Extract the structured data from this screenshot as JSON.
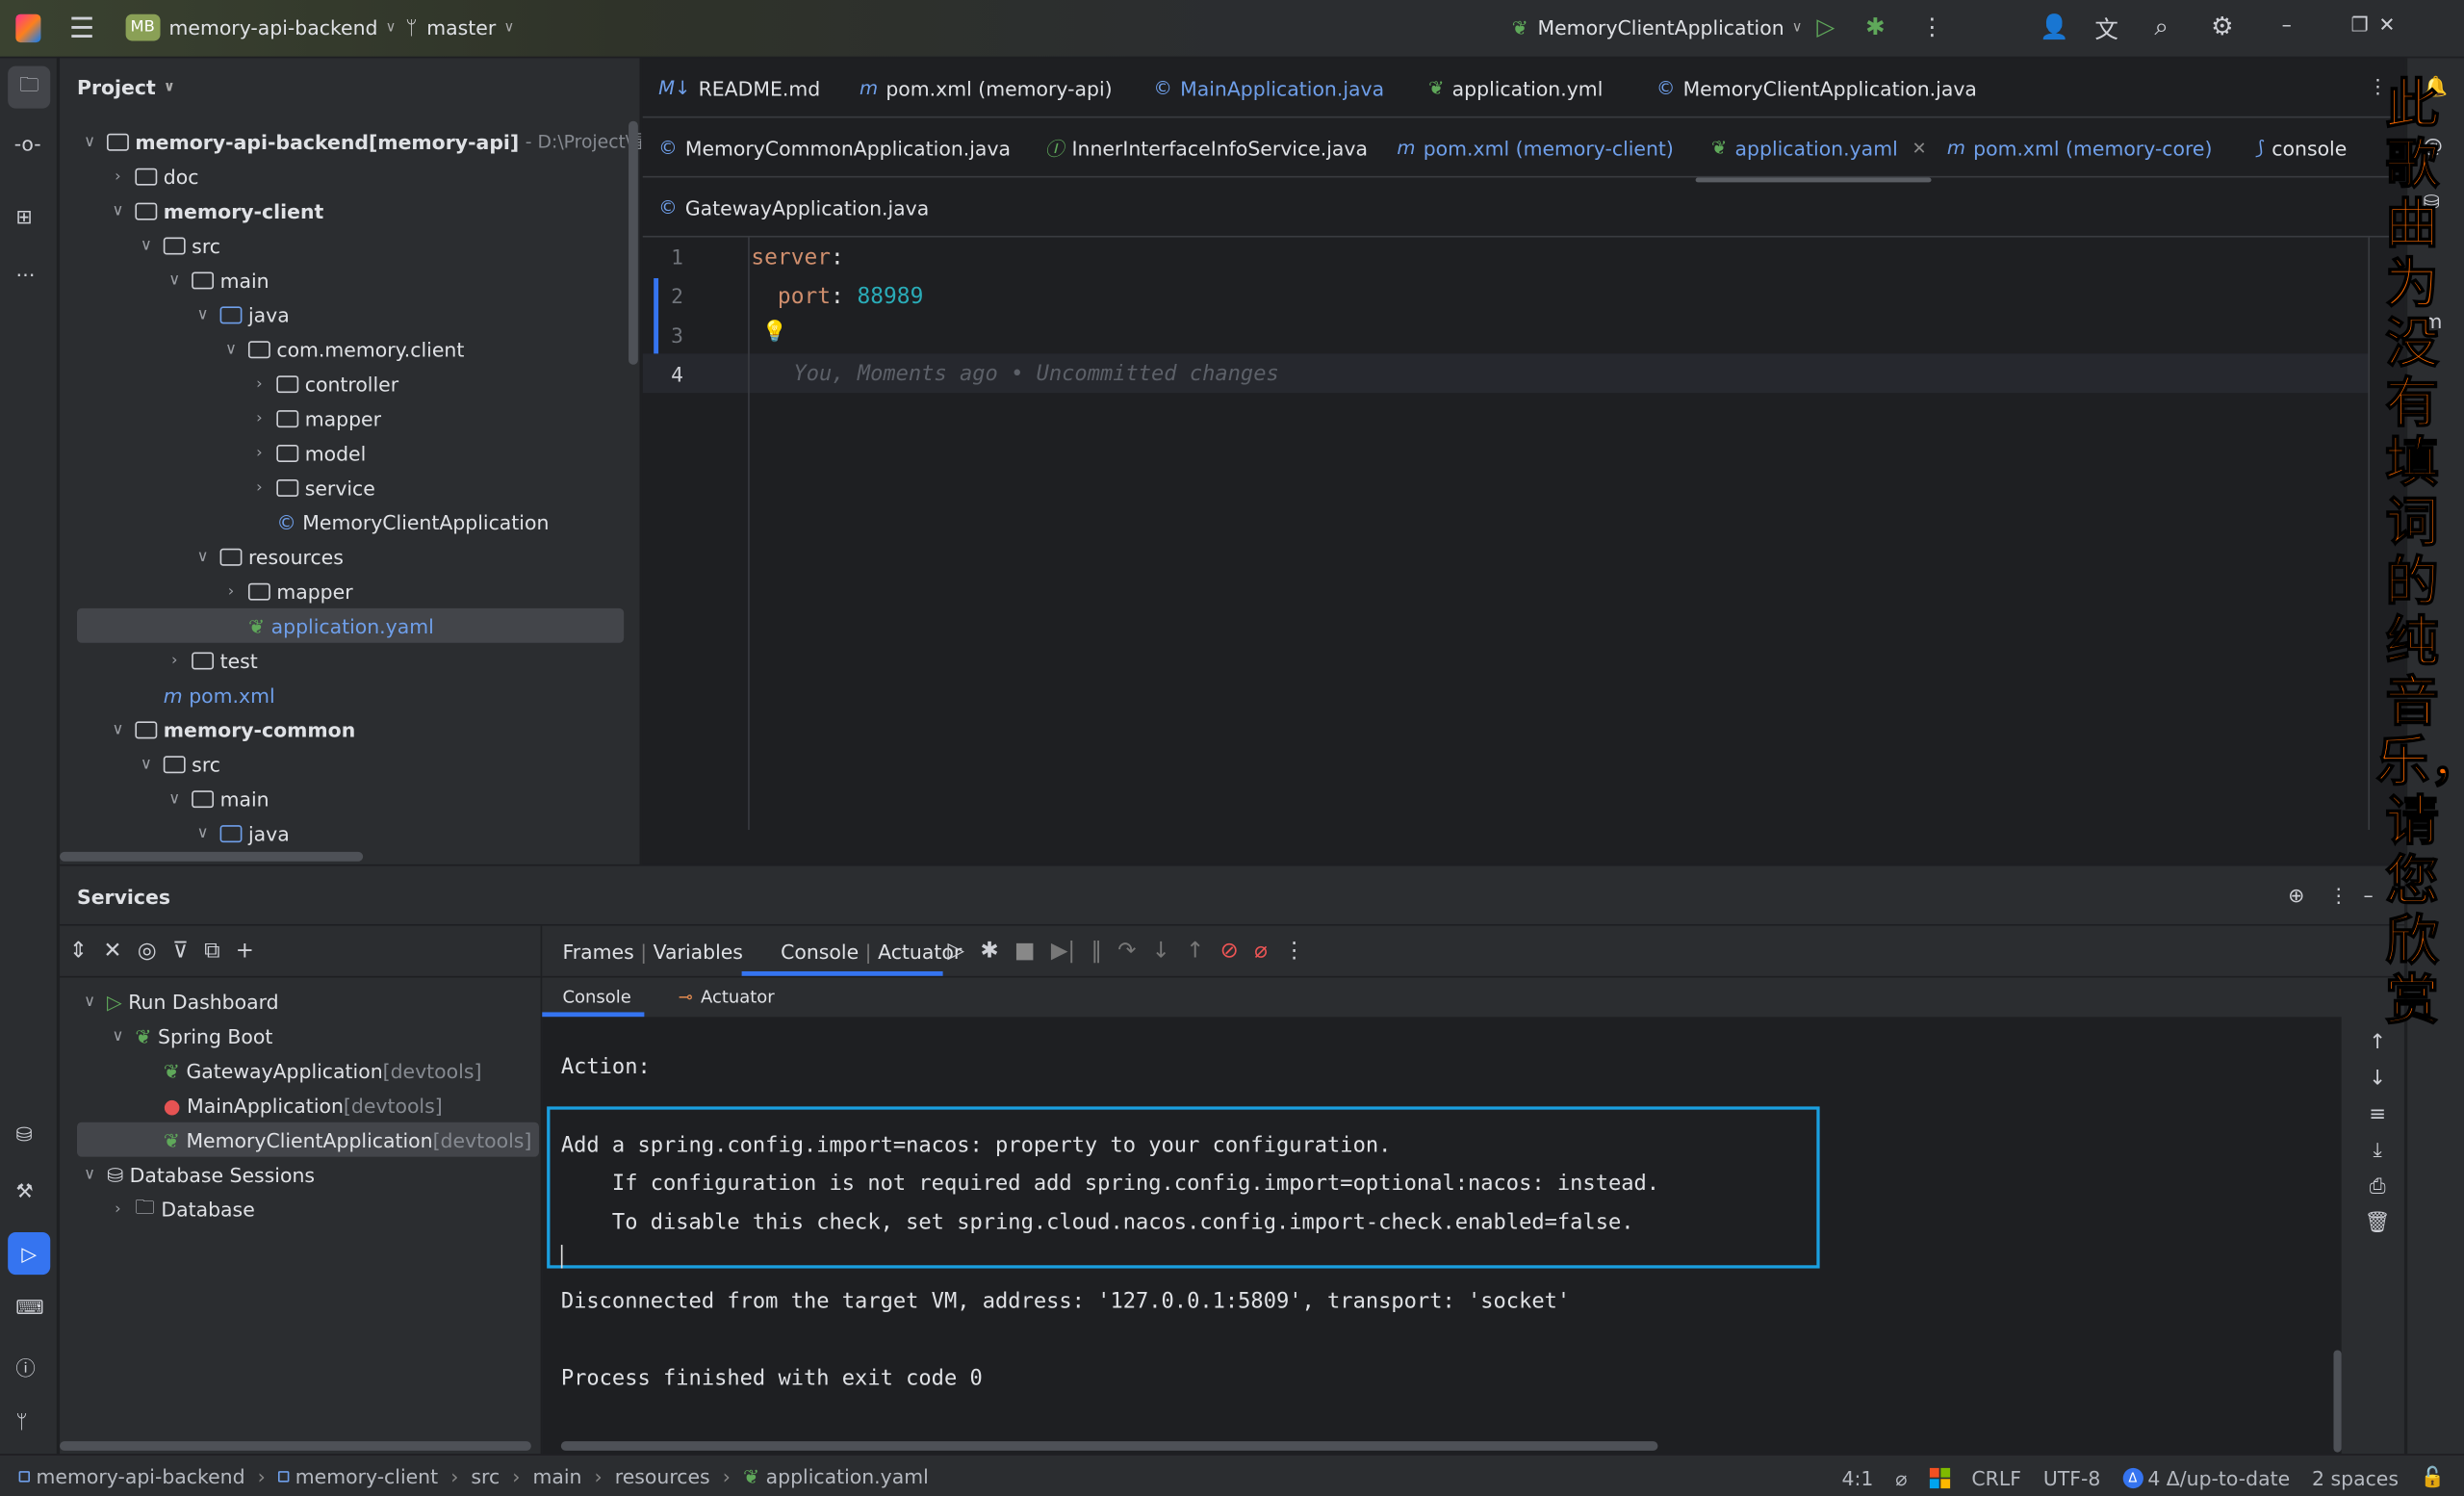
{
  "titlebar": {
    "project_badge": "MB",
    "project": "memory-api-backend",
    "branch": "master",
    "run_config": "MemoryClientApplication"
  },
  "project_panel": {
    "title": "Project",
    "items": [
      {
        "label": "memory-api-backend",
        "bold_suffix": " [memory-api]",
        "path": " - D:\\Project\\星球项",
        "indent": 0,
        "open": true,
        "type": "module"
      },
      {
        "label": "doc",
        "indent": 1,
        "open": false,
        "type": "folder"
      },
      {
        "label": "memory-client",
        "indent": 1,
        "open": true,
        "type": "module",
        "bold": true
      },
      {
        "label": "src",
        "indent": 2,
        "open": true,
        "type": "folder"
      },
      {
        "label": "main",
        "indent": 3,
        "open": true,
        "type": "folder"
      },
      {
        "label": "java",
        "indent": 4,
        "open": true,
        "type": "folder"
      },
      {
        "label": "com.memory.client",
        "indent": 5,
        "open": true,
        "type": "package"
      },
      {
        "label": "controller",
        "indent": 6,
        "open": false,
        "type": "package"
      },
      {
        "label": "mapper",
        "indent": 6,
        "open": false,
        "type": "package"
      },
      {
        "label": "model",
        "indent": 6,
        "open": false,
        "type": "package"
      },
      {
        "label": "service",
        "indent": 6,
        "open": false,
        "type": "package"
      },
      {
        "label": "MemoryClientApplication",
        "indent": 6,
        "type": "class"
      },
      {
        "label": "resources",
        "indent": 4,
        "open": true,
        "type": "folder"
      },
      {
        "label": "mapper",
        "indent": 5,
        "open": false,
        "type": "folder"
      },
      {
        "label": "application.yaml",
        "indent": 5,
        "type": "yaml",
        "selected": true
      },
      {
        "label": "test",
        "indent": 3,
        "open": false,
        "type": "folder"
      },
      {
        "label": "pom.xml",
        "indent": 2,
        "type": "maven"
      },
      {
        "label": "memory-common",
        "indent": 1,
        "open": true,
        "type": "module",
        "bold": true
      },
      {
        "label": "src",
        "indent": 2,
        "open": true,
        "type": "folder"
      },
      {
        "label": "main",
        "indent": 3,
        "open": true,
        "type": "folder"
      },
      {
        "label": "java",
        "indent": 4,
        "open": true,
        "type": "folder"
      }
    ]
  },
  "editor_tabs": [
    [
      {
        "label": "README.md",
        "icon": "M↓",
        "kind": "md"
      },
      {
        "label": "pom.xml (memory-api)",
        "icon": "m",
        "kind": "maven"
      },
      {
        "label": "MainApplication.java",
        "icon": "©",
        "kind": "class",
        "blue": true
      },
      {
        "label": "application.yml",
        "icon": "❦",
        "kind": "spring"
      },
      {
        "label": "MemoryClientApplication.java",
        "icon": "©",
        "kind": "class"
      }
    ],
    [
      {
        "label": "MemoryCommonApplication.java",
        "icon": "©",
        "kind": "class"
      },
      {
        "label": "InnerInterfaceInfoService.java",
        "icon": "Ⓘ",
        "kind": "interface"
      },
      {
        "label": "pom.xml (memory-client)",
        "icon": "m",
        "kind": "maven",
        "blue": true
      },
      {
        "label": "application.yaml",
        "icon": "❦",
        "kind": "spring",
        "blue": true,
        "active": true
      },
      {
        "label": "pom.xml (memory-core)",
        "icon": "m",
        "kind": "maven",
        "blue": true
      },
      {
        "label": "console",
        "icon": "⟆",
        "kind": "console"
      }
    ],
    [
      {
        "label": "GatewayApplication.java",
        "icon": "©",
        "kind": "class"
      }
    ]
  ],
  "editor": {
    "lines": [
      {
        "n": "1",
        "key": "server",
        "colon": ":",
        "value": ""
      },
      {
        "n": "2",
        "key": "  port",
        "colon": ":",
        "value": " 88989"
      },
      {
        "n": "3",
        "key": "",
        "colon": "",
        "value": ""
      },
      {
        "n": "4",
        "key": "",
        "colon": "",
        "value": ""
      }
    ],
    "blame": "You, Moments ago • Uncommitted changes"
  },
  "services": {
    "title": "Services",
    "tree": [
      {
        "label": "Run Dashboard",
        "indent": 0,
        "icon": "run"
      },
      {
        "label": "Spring Boot",
        "indent": 1,
        "icon": "spring"
      },
      {
        "label": "GatewayApplication",
        "suffix": " [devtools]",
        "indent": 2,
        "icon": "spring"
      },
      {
        "label": "MainApplication",
        "suffix": " [devtools]",
        "indent": 2,
        "icon": "error"
      },
      {
        "label": "MemoryClientApplication",
        "suffix": " [devtools]",
        "indent": 2,
        "icon": "spring",
        "selected": true
      },
      {
        "label": "Database Sessions",
        "indent": 0,
        "icon": "db"
      },
      {
        "label": "Database",
        "indent": 1,
        "icon": "folder"
      }
    ],
    "tabs": {
      "frames": "Frames",
      "variables": "Variables",
      "console": "Console",
      "actuator": "Actuator"
    },
    "subtabs": {
      "console": "Console",
      "actuator": "Actuator"
    },
    "console_lines": {
      "action": "Action:",
      "l1": "Add a spring.config.import=nacos: property to your configuration.",
      "l2": "    If configuration is not required add spring.config.import=optional:nacos: instead.",
      "l3": "    To disable this check, set spring.cloud.nacos.config.import-check.enabled=false.",
      "disconnected": "Disconnected from the target VM, address: '127.0.0.1:5809', transport: 'socket'",
      "finished": "Process finished with exit code 0"
    }
  },
  "statusbar": {
    "breadcrumb": [
      "memory-api-backend",
      "memory-client",
      "src",
      "main",
      "resources",
      "application.yaml"
    ],
    "position": "4:1",
    "line_sep": "CRLF",
    "encoding": "UTF-8",
    "vcs": "4 Δ/up-to-date",
    "indent": "2 spaces"
  },
  "overlay_text": "此歌曲为没有填词的纯音乐，请您欣赏",
  "colors": {
    "accent": "#3574f0",
    "highlight_box": "#1a9fe0",
    "overlay": "#ff6a00"
  }
}
